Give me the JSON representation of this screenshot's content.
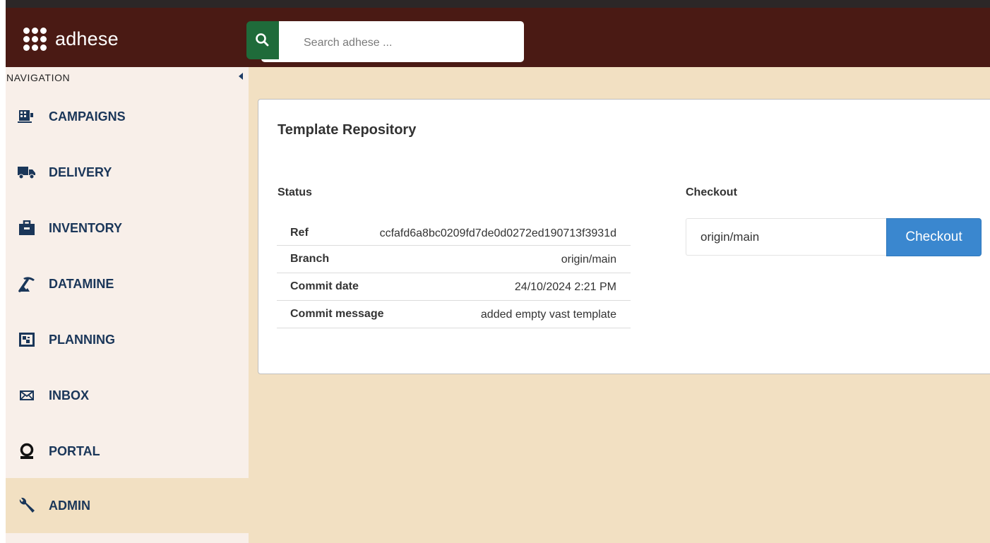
{
  "app": {
    "logo_text": "adhese"
  },
  "search": {
    "placeholder": "Search adhese ..."
  },
  "sidebar": {
    "header": "NAVIGATION",
    "items": [
      {
        "label": "CAMPAIGNS",
        "icon": "campaigns-icon"
      },
      {
        "label": "DELIVERY",
        "icon": "truck-icon"
      },
      {
        "label": "INVENTORY",
        "icon": "briefcase-icon"
      },
      {
        "label": "DATAMINE",
        "icon": "pickaxe-icon"
      },
      {
        "label": "PLANNING",
        "icon": "planning-icon"
      },
      {
        "label": "INBOX",
        "icon": "envelope-icon"
      },
      {
        "label": "PORTAL",
        "icon": "portal-icon"
      },
      {
        "label": "ADMIN",
        "icon": "wrench-icon",
        "active": true
      }
    ]
  },
  "main": {
    "title": "Template Repository",
    "status": {
      "title": "Status",
      "rows": [
        {
          "key": "Ref",
          "value": "ccfafd6a8bc0209fd7de0d0272ed190713f3931d"
        },
        {
          "key": "Branch",
          "value": "origin/main"
        },
        {
          "key": "Commit date",
          "value": "24/10/2024 2:21 PM"
        },
        {
          "key": "Commit message",
          "value": "added empty vast template"
        }
      ]
    },
    "checkout": {
      "title": "Checkout",
      "input_value": "origin/main",
      "button_label": "Checkout"
    }
  },
  "colors": {
    "topbar": "#4a1a14",
    "sidebar": "#f8efe9",
    "content_bg": "#f2e0c2",
    "nav_text": "#1a3659",
    "search_accent": "#1f6b3a",
    "button": "#3a87cf"
  }
}
